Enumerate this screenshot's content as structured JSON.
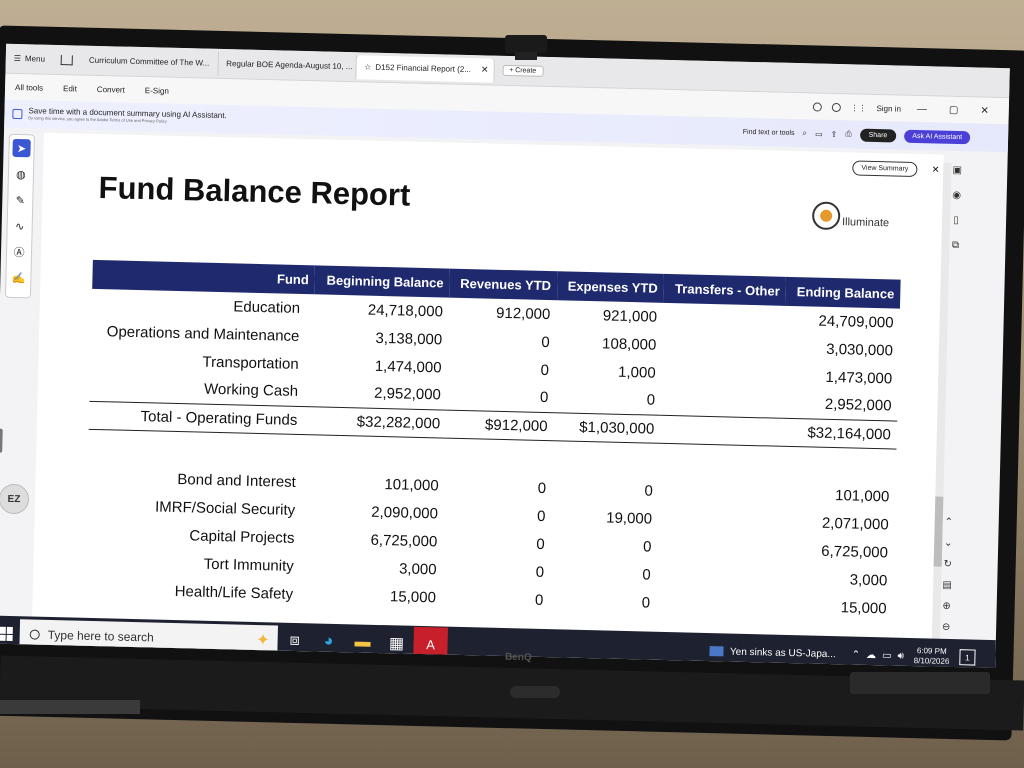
{
  "browser": {
    "menu_label": "Menu",
    "tabs": [
      {
        "label": "Curriculum Committee of The W..."
      },
      {
        "label": "Regular BOE Agenda-August 10, ..."
      },
      {
        "label": "D152 Financial Report (2..."
      }
    ],
    "create_label": "+ Create",
    "menu_items": [
      "All tools",
      "Edit",
      "Convert",
      "E-Sign"
    ],
    "sign_in": "Sign in",
    "ai_banner": "Save time with a document summary using AI Assistant.",
    "ai_fineprint": "By using this service, you agree to the Adobe Terms of Use and Privacy Policy",
    "find_label": "Find text or tools",
    "share_label": "Share",
    "ask_ai_label": "Ask AI Assistant",
    "view_summary": "View Summary",
    "ez_label": "EZ"
  },
  "report": {
    "title": "Fund Balance Report",
    "logo_text": "Illuminate",
    "columns": [
      "Fund",
      "Beginning Balance",
      "Revenues YTD",
      "Expenses YTD",
      "Transfers - Other",
      "Ending Balance"
    ],
    "operating_rows": [
      {
        "fund": "Education",
        "beginning": "24,718,000",
        "revenues": "912,000",
        "expenses": "921,000",
        "transfers": "",
        "ending": "24,709,000"
      },
      {
        "fund": "Operations and Maintenance",
        "beginning": "3,138,000",
        "revenues": "0",
        "expenses": "108,000",
        "transfers": "",
        "ending": "3,030,000"
      },
      {
        "fund": "Transportation",
        "beginning": "1,474,000",
        "revenues": "0",
        "expenses": "1,000",
        "transfers": "",
        "ending": "1,473,000"
      },
      {
        "fund": "Working Cash",
        "beginning": "2,952,000",
        "revenues": "0",
        "expenses": "0",
        "transfers": "",
        "ending": "2,952,000"
      }
    ],
    "total": {
      "fund": "Total - Operating Funds",
      "beginning": "$32,282,000",
      "revenues": "$912,000",
      "expenses": "$1,030,000",
      "transfers": "",
      "ending": "$32,164,000"
    },
    "other_rows": [
      {
        "fund": "Bond and Interest",
        "beginning": "101,000",
        "revenues": "0",
        "expenses": "0",
        "transfers": "",
        "ending": "101,000"
      },
      {
        "fund": "IMRF/Social Security",
        "beginning": "2,090,000",
        "revenues": "0",
        "expenses": "19,000",
        "transfers": "",
        "ending": "2,071,000"
      },
      {
        "fund": "Capital Projects",
        "beginning": "6,725,000",
        "revenues": "0",
        "expenses": "0",
        "transfers": "",
        "ending": "6,725,000"
      },
      {
        "fund": "Tort Immunity",
        "beginning": "3,000",
        "revenues": "0",
        "expenses": "0",
        "transfers": "",
        "ending": "3,000"
      },
      {
        "fund": "Health/Life Safety",
        "beginning": "15,000",
        "revenues": "0",
        "expenses": "0",
        "transfers": "",
        "ending": "15,000"
      }
    ]
  },
  "taskbar": {
    "search_placeholder": "Type here to search",
    "news": "Yen sinks as US-Japa...",
    "time": "6:09 PM",
    "date": "8/10/2026",
    "notif_count": "1"
  },
  "monitor": {
    "brand": "BenQ"
  },
  "colors": {
    "header_bg": "#1f2a6e",
    "accent": "#4b3fd8"
  }
}
